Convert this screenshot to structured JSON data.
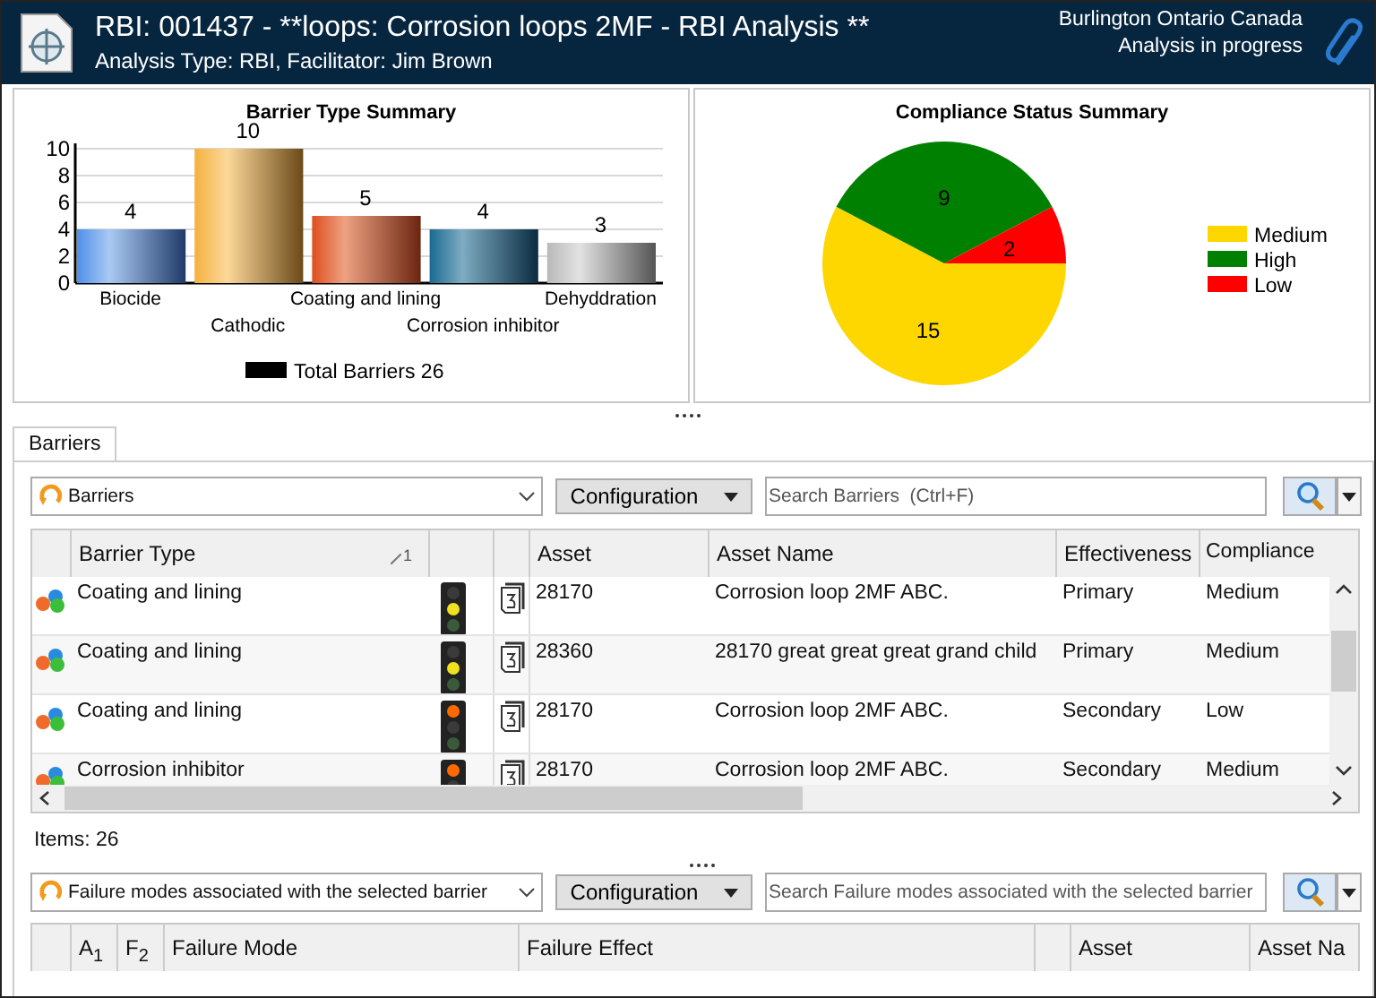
{
  "window": {
    "title": "RBI: 001437 - **loops: Corrosion loops 2MF  - RBI Analysis **",
    "subtitle": "Analysis Type: RBI, Facilitator: Jim Brown",
    "location": "Burlington Ontario Canada",
    "status": "Analysis in progress"
  },
  "barrier_chart": {
    "chart_data": {
      "type": "bar",
      "title": "Barrier Type Summary",
      "categories": [
        "Biocide",
        "Cathodic",
        "Coating and lining",
        "Corrosion inhibitor",
        "Dehyddration"
      ],
      "series": [
        {
          "name": "Total  Barriers 26",
          "values": [
            4,
            10,
            5,
            4,
            3
          ]
        }
      ],
      "ylim": [
        0,
        10
      ],
      "yticks": [
        0,
        2,
        4,
        6,
        8,
        10
      ],
      "data_labels": true,
      "grid": true,
      "legend": "bottom"
    }
  },
  "compliance_chart": {
    "chart_data": {
      "type": "pie",
      "title": "Compliance Status Summary",
      "categories": [
        "Medium",
        "High",
        "Low"
      ],
      "values": [
        15,
        9,
        2
      ],
      "data_labels": true,
      "legend": "right"
    },
    "slices": [
      {
        "color": "#ffd700"
      },
      {
        "color": "#008000"
      },
      {
        "color": "#ff0000"
      }
    ]
  },
  "tabs": [
    {
      "label": "Barriers",
      "selected": true
    }
  ],
  "barriers": {
    "view": "Barriers",
    "config_button": "Configuration",
    "search": {
      "placeholder": "Search Barriers  (Ctrl+F)"
    },
    "columns": [
      {
        "label": "Barrier Type",
        "sort_index": "1"
      },
      {
        "label": "Asset"
      },
      {
        "label": "Asset Name"
      },
      {
        "label": "Effectiveness"
      },
      {
        "label": "Compliance"
      }
    ],
    "rows": [
      {
        "barrier_type": "Coating and lining",
        "kind": "amber",
        "asset": "28170",
        "asset_name": "Corrosion loop 2MF ABC.",
        "effectiveness": "Primary",
        "compliance": "Medium"
      },
      {
        "barrier_type": "Coating and lining",
        "kind": "amber",
        "asset": "28360",
        "asset_name": "28170 great great great grand child",
        "effectiveness": "Primary",
        "compliance": "Medium"
      },
      {
        "barrier_type": "Coating and lining",
        "kind": "red",
        "asset": "28170",
        "asset_name": "Corrosion loop 2MF ABC.",
        "effectiveness": "Secondary",
        "compliance": "Low"
      },
      {
        "barrier_type": "Corrosion inhibitor",
        "kind": "red",
        "asset": "28170",
        "asset_name": "Corrosion loop 2MF ABC.",
        "effectiveness": "Secondary",
        "compliance": "Medium"
      }
    ],
    "items": "Items: 26"
  },
  "failure_modes": {
    "view": "Failure modes associated with the selected barrier",
    "config_button": "Configuration",
    "search": {
      "placeholder": "Search Failure modes associated with the selected barrier"
    },
    "columns": [
      {
        "label": "A$_{1}$"
      },
      {
        "label": "F$_{2}$"
      },
      {
        "label": "Failure Mode"
      },
      {
        "label": "Failure Effect"
      },
      {
        "label": "Asset"
      },
      {
        "label": "Asset Na"
      }
    ]
  }
}
